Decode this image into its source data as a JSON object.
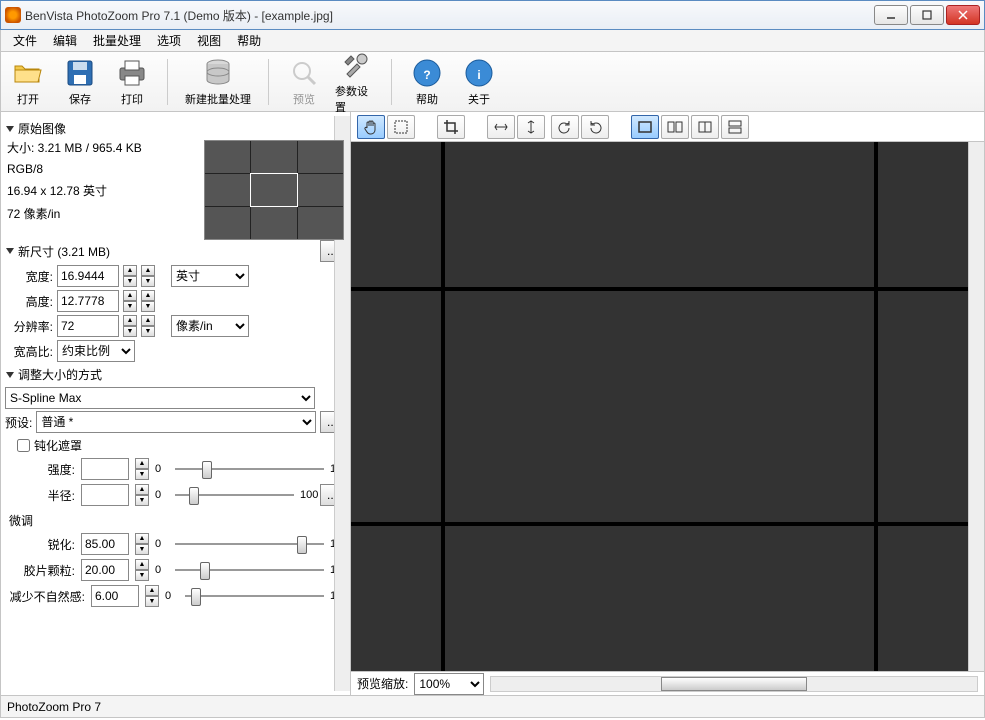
{
  "window": {
    "title": "BenVista PhotoZoom Pro 7.1 (Demo 版本) - [example.jpg]"
  },
  "menu": {
    "file": "文件",
    "edit": "编辑",
    "batch": "批量处理",
    "options": "选项",
    "view": "视图",
    "help": "帮助"
  },
  "toolbar": {
    "open": "打开",
    "save": "保存",
    "print": "打印",
    "newbatch": "新建批量处理",
    "preview": "预览",
    "params": "参数设置",
    "helpb": "帮助",
    "about": "关于"
  },
  "orig": {
    "header": "原始图像",
    "size_line": "大小: 3.21 MB / 965.4 KB",
    "mode": "RGB/8",
    "dim": "16.94 x 12.78 英寸",
    "res": "72 像素/in"
  },
  "newsize": {
    "header": "新尺寸 (3.21 MB)",
    "width_lbl": "宽度:",
    "width_val": "16.9444",
    "height_lbl": "高度:",
    "height_val": "12.7778",
    "unit": "英寸",
    "res_lbl": "分辨率:",
    "res_val": "72",
    "res_unit": "像素/in",
    "ar_lbl": "宽高比:",
    "ar_val": "约束比例"
  },
  "resize": {
    "header": "调整大小的方式",
    "method": "S-Spline Max",
    "preset_lbl": "预设:",
    "preset_val": "普通 *",
    "unsharp": "钝化遮罩",
    "strength": "强度:",
    "radius": "半径:",
    "finetune": "微调",
    "sharp": "锐化:",
    "sharp_val": "85.00",
    "grain": "胶片颗粒:",
    "grain_val": "20.00",
    "artifact": "减少不自然感:",
    "artifact_val": "6.00",
    "min": "0",
    "max": "100"
  },
  "previewbar": {
    "label": "预览缩放:",
    "zoom": "100%"
  },
  "status": {
    "text": "PhotoZoom Pro 7"
  }
}
